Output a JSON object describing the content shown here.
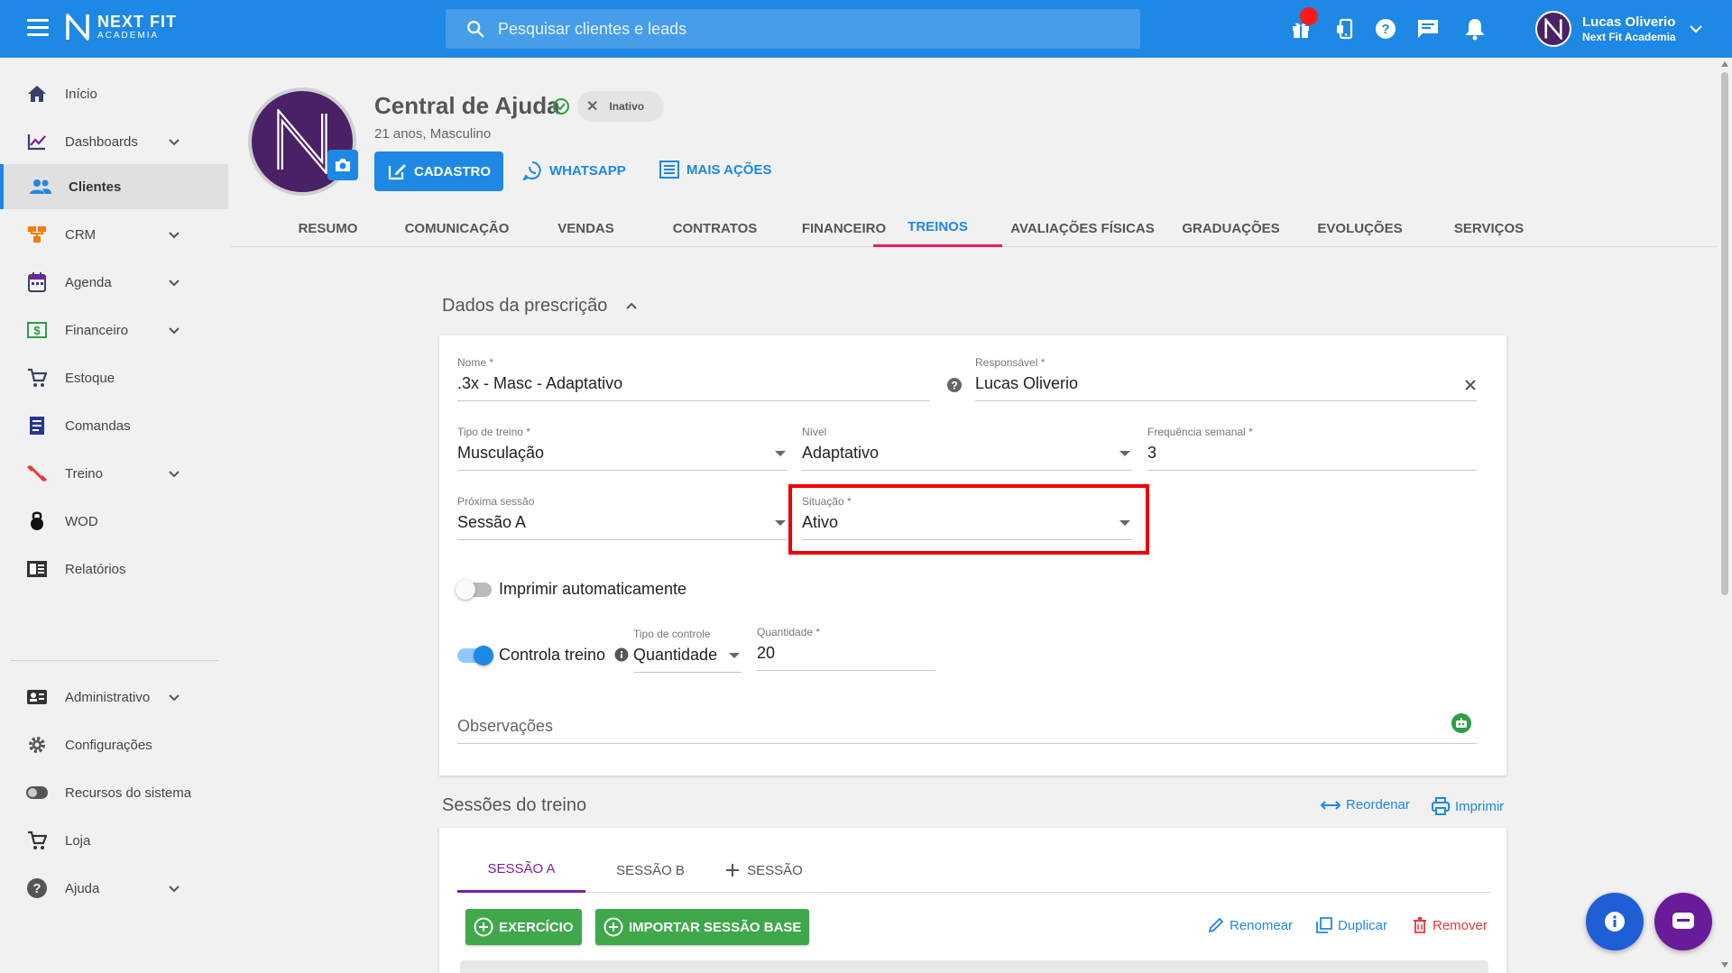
{
  "topbar": {
    "logo_line1": "NEXT FIT",
    "logo_line2": "ACADEMIA",
    "search_placeholder": "Pesquisar clientes e leads",
    "icons": [
      "gift-icon",
      "mobile-icon",
      "help-icon",
      "chat-icon",
      "bell-icon"
    ],
    "user_name": "Lucas Oliverio",
    "user_org": "Next Fit Academia"
  },
  "sidebar": {
    "items": [
      {
        "label": "Início",
        "icon": "home-icon",
        "caret": false
      },
      {
        "label": "Dashboards",
        "icon": "chart-icon",
        "caret": true
      },
      {
        "label": "Clientes",
        "icon": "people-icon",
        "caret": false,
        "active": true
      },
      {
        "label": "CRM",
        "icon": "crm-icon",
        "caret": true
      },
      {
        "label": "Agenda",
        "icon": "calendar-icon",
        "caret": true
      },
      {
        "label": "Financeiro",
        "icon": "money-icon",
        "caret": true
      },
      {
        "label": "Estoque",
        "icon": "cart-icon",
        "caret": false
      },
      {
        "label": "Comandas",
        "icon": "receipt-icon",
        "caret": false
      },
      {
        "label": "Treino",
        "icon": "dumbbell-icon",
        "caret": true
      },
      {
        "label": "WOD",
        "icon": "kettlebell-icon",
        "caret": false
      },
      {
        "label": "Relatórios",
        "icon": "report-icon",
        "caret": false
      },
      {
        "label": "Administrativo",
        "icon": "id-card-icon",
        "caret": true
      },
      {
        "label": "Configurações",
        "icon": "gear-icon",
        "caret": false
      },
      {
        "label": "Recursos do sistema",
        "icon": "toggle-icon",
        "caret": false
      },
      {
        "label": "Loja",
        "icon": "cart-icon",
        "caret": false
      },
      {
        "label": "Ajuda",
        "icon": "help-icon",
        "caret": true
      }
    ]
  },
  "profile": {
    "name": "Central de Ajuda",
    "status_chip": "Inativo",
    "subtitle": "21 anos, Masculino",
    "btn_cadastro": "CADASTRO",
    "btn_whatsapp": "WHATSAPP",
    "btn_mais": "MAIS AÇÕES"
  },
  "tabs": [
    "RESUMO",
    "COMUNICAÇÃO",
    "VENDAS",
    "CONTRATOS",
    "FINANCEIRO",
    "TREINOS",
    "AVALIAÇÕES FÍSICAS",
    "GRADUAÇÕES",
    "EVOLUÇÕES",
    "SERVIÇOS"
  ],
  "active_tab": "TREINOS",
  "prescricao": {
    "title": "Dados da prescrição",
    "nome_label": "Nome *",
    "nome_value": ".3x - Masc - Adaptativo",
    "responsavel_label": "Responsável *",
    "responsavel_value": "Lucas Oliverio",
    "tipo_label": "Tipo de treino *",
    "tipo_value": "Musculação",
    "nivel_label": "Nível",
    "nivel_value": "Adaptativo",
    "freq_label": "Frequência semanal *",
    "freq_value": "3",
    "proxima_label": "Próxima sessão",
    "proxima_value": "Sessão A",
    "situacao_label": "Situação *",
    "situacao_value": "Ativo",
    "imprimir_label": "Imprimir automaticamente",
    "imprimir_on": false,
    "controla_label": "Controla treino",
    "controla_on": true,
    "tipo_controle_label": "Tipo de controle",
    "tipo_controle_value": "Quantidade",
    "quantidade_label": "Quantidade *",
    "quantidade_value": "20",
    "observacoes_placeholder": "Observações"
  },
  "sessoes": {
    "title": "Sessões do treino",
    "reordenar": "Reordenar",
    "imprimir": "Imprimir",
    "tabs": [
      "SESSÃO A",
      "SESSÃO B",
      "SESSÃO"
    ],
    "btn_exercicio": "EXERCÍCIO",
    "btn_importar": "IMPORTAR SESSÃO BASE",
    "renomear": "Renomear",
    "duplicar": "Duplicar",
    "remover": "Remover"
  },
  "colors": {
    "primary": "#1e88e5",
    "green": "#3ea84a",
    "purple": "#7b1fa2",
    "danger": "#e53935",
    "highlight": "#ee0000"
  }
}
